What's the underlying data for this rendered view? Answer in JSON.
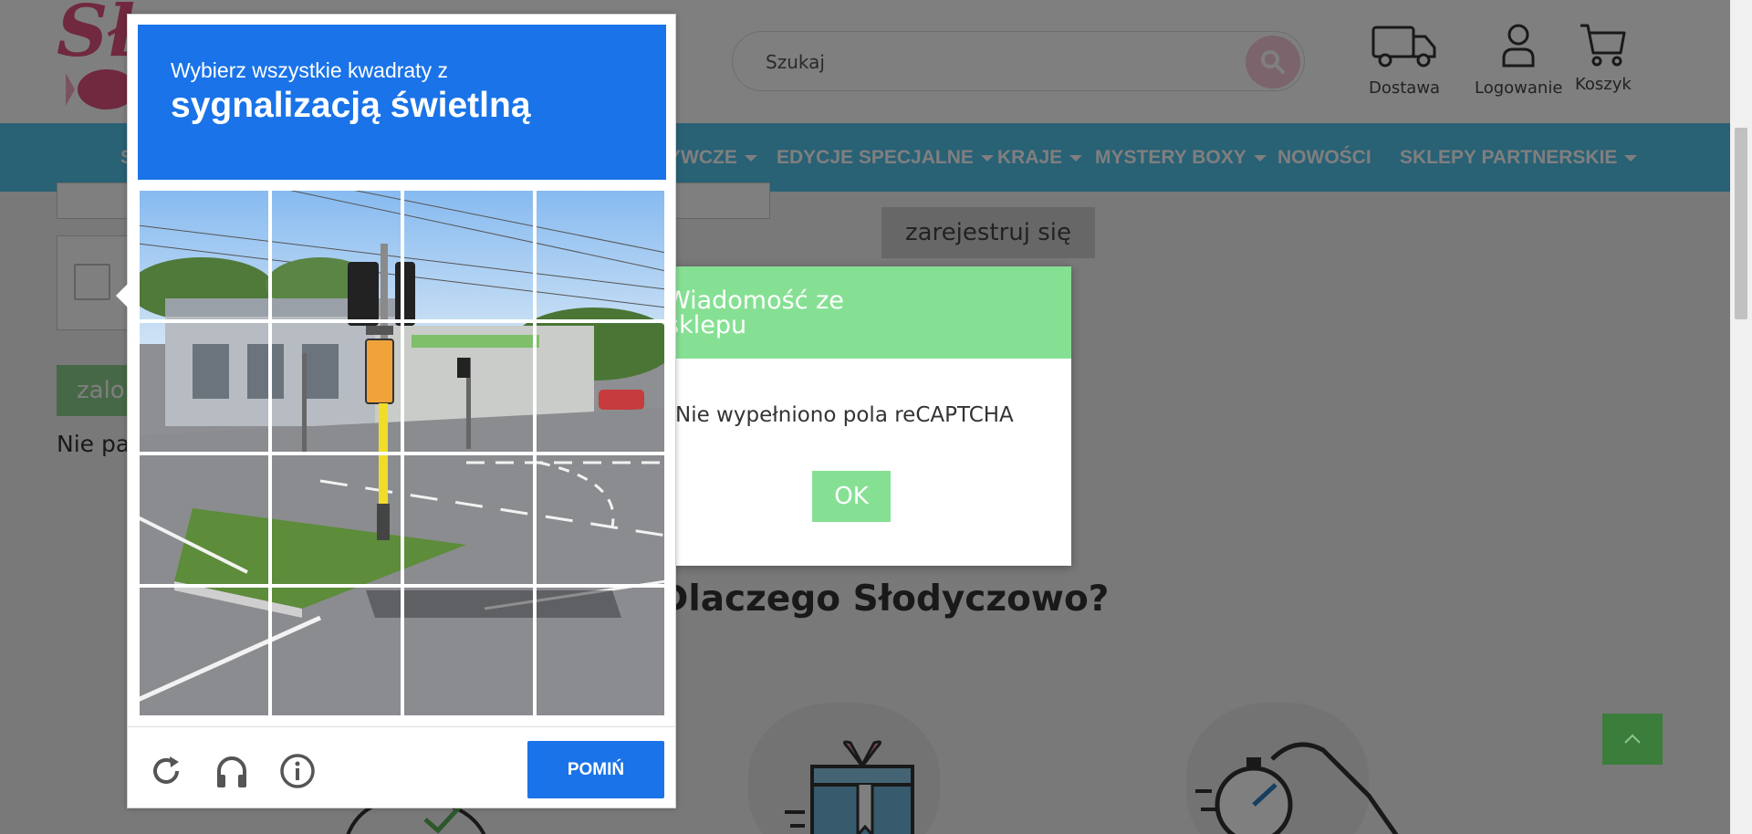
{
  "header": {
    "logo_text": "Sło",
    "search_placeholder": "Szukaj",
    "icons": [
      {
        "name": "delivery",
        "label": "Dostawa"
      },
      {
        "name": "account",
        "label": "Logowanie"
      },
      {
        "name": "cart",
        "label": "Koszyk"
      }
    ]
  },
  "nav": {
    "items": [
      {
        "label": "S",
        "caret": false
      },
      {
        "label": "YWCZE",
        "caret": true
      },
      {
        "label": "EDYCJE SPECJALNE",
        "caret": true
      },
      {
        "label": "KRAJE",
        "caret": true
      },
      {
        "label": "MYSTERY BOXY",
        "caret": true
      },
      {
        "label": "NOWOŚCI",
        "caret": false
      },
      {
        "label": "SKLEPY PARTNERSKIE",
        "caret": true
      }
    ]
  },
  "content": {
    "register_label": "zarejestruj się",
    "login_label": "zalo",
    "forgot_label": "Nie pa",
    "why_title": "Dlaczego Słodyczowo?"
  },
  "store_dialog": {
    "title_line1": "Wiadomość ze",
    "title_line2": "sklepu",
    "message": "Nie wypełniono pola reCAPTCHA",
    "ok_label": "OK"
  },
  "captcha": {
    "instruction_line1": "Wybierz wszystkie kwadraty z",
    "instruction_line2": "sygnalizacją świetlną",
    "grid_rows": 4,
    "grid_cols": 4,
    "skip_label": "POMIŃ",
    "footer_icons": [
      "reload-icon",
      "headphones-icon",
      "info-icon"
    ]
  },
  "colors": {
    "nav_bg": "#53c3ea",
    "captcha_blue": "#1a73e8",
    "dialog_green": "#86e094",
    "brand_pink": "#e0527d"
  }
}
